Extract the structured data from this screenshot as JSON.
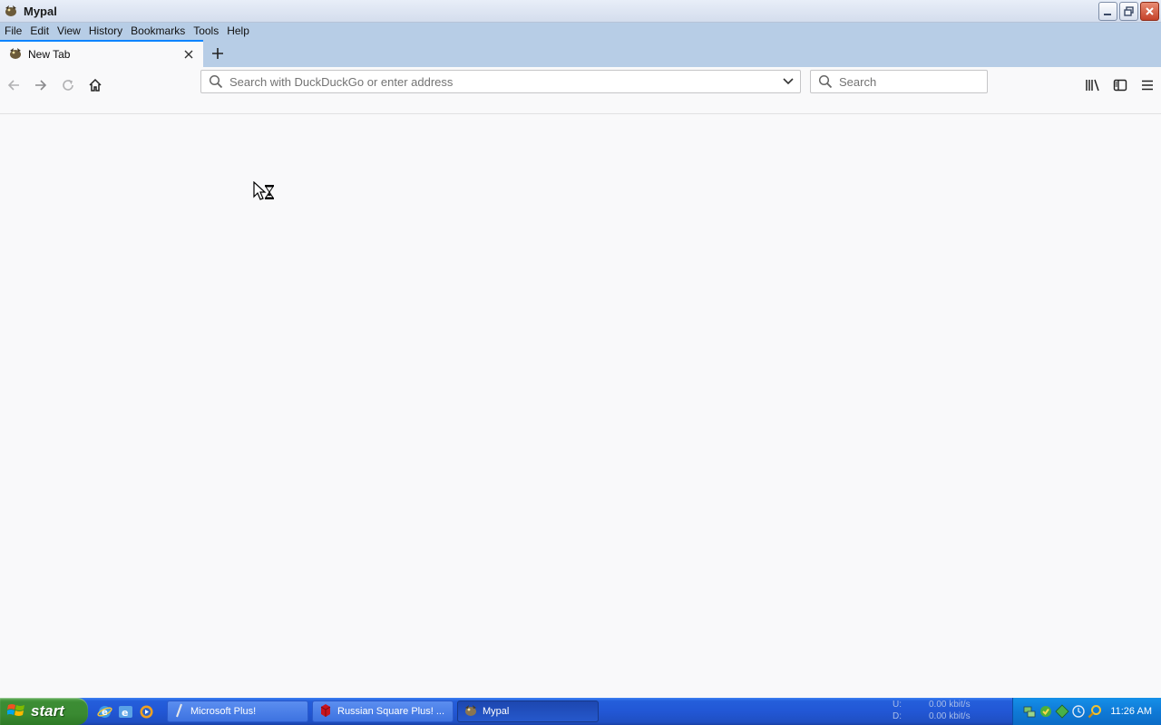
{
  "window": {
    "title": "Mypal",
    "controls": {
      "minimize": "minimize",
      "restore": "restore",
      "close": "close"
    }
  },
  "menubar": {
    "items": [
      {
        "label": "File"
      },
      {
        "label": "Edit"
      },
      {
        "label": "View"
      },
      {
        "label": "History"
      },
      {
        "label": "Bookmarks"
      },
      {
        "label": "Tools"
      },
      {
        "label": "Help"
      }
    ]
  },
  "tabs": [
    {
      "label": "New Tab",
      "active": true
    }
  ],
  "navbar": {
    "urlbar": {
      "placeholder": "Search with DuckDuckGo or enter address",
      "value": ""
    },
    "searchbar": {
      "placeholder": "Search",
      "value": ""
    }
  },
  "cursor": {
    "state": "busy"
  },
  "taskbar": {
    "start_label": "start",
    "tasks": [
      {
        "label": "Microsoft Plus!",
        "active": false
      },
      {
        "label": "Russian Square Plus! ...",
        "active": false
      },
      {
        "label": "Mypal",
        "active": true
      }
    ],
    "netmeter": {
      "up_label": "U:",
      "up_value": "0.00 kbit/s",
      "down_label": "D:",
      "down_value": "0.00 kbit/s"
    },
    "clock": "11:26 AM"
  },
  "colors": {
    "accent": "#0a84ff",
    "chrome_blue": "#b7cde6",
    "taskbar": "#245edb",
    "start": "#3c8d34"
  }
}
